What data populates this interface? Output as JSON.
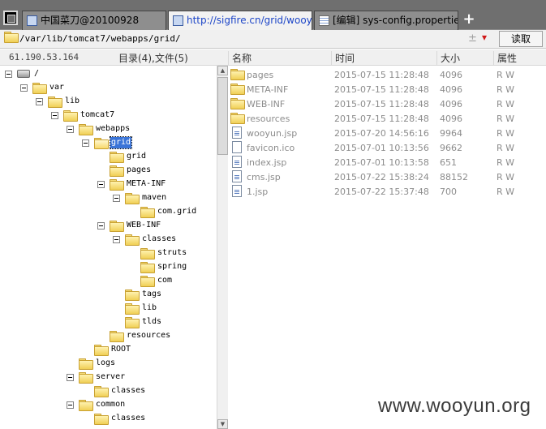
{
  "tabs": [
    {
      "label": "中国菜刀@20100928"
    },
    {
      "label": "http://sigfire.cn/grid/wooyun.j..."
    },
    {
      "label": "[编辑] sys-config.properties"
    }
  ],
  "new_tab_label": "+",
  "pathbar": {
    "path": "/var/lib/tomcat7/webapps/grid/",
    "clear_icon": "±",
    "dropdown_icon": "▾",
    "read_button": "读取"
  },
  "left_header": {
    "ip": "61.190.53.164",
    "count": "目录(4),文件(5)"
  },
  "tree": [
    {
      "label": "/",
      "level": 0,
      "icon": "drive-icon",
      "expanded": true
    },
    {
      "label": "var",
      "level": 1,
      "expanded": true
    },
    {
      "label": "lib",
      "level": 2,
      "expanded": true
    },
    {
      "label": "tomcat7",
      "level": 3,
      "expanded": true
    },
    {
      "label": "webapps",
      "level": 4,
      "expanded": true
    },
    {
      "label": "grid",
      "level": 5,
      "expanded": true,
      "selected": true,
      "open": true
    },
    {
      "label": "grid",
      "level": 6
    },
    {
      "label": "pages",
      "level": 6
    },
    {
      "label": "META-INF",
      "level": 6,
      "expanded": true
    },
    {
      "label": "maven",
      "level": 7,
      "expanded": true
    },
    {
      "label": "com.grid",
      "level": 8
    },
    {
      "label": "WEB-INF",
      "level": 6,
      "expanded": true
    },
    {
      "label": "classes",
      "level": 7,
      "expanded": true
    },
    {
      "label": "struts",
      "level": 8
    },
    {
      "label": "spring",
      "level": 8
    },
    {
      "label": "com",
      "level": 8
    },
    {
      "label": "tags",
      "level": 7
    },
    {
      "label": "lib",
      "level": 7
    },
    {
      "label": "tlds",
      "level": 7
    },
    {
      "label": "resources",
      "level": 6
    },
    {
      "label": "ROOT",
      "level": 5
    },
    {
      "label": "logs",
      "level": 4
    },
    {
      "label": "server",
      "level": 4,
      "expanded": true
    },
    {
      "label": "classes",
      "level": 5
    },
    {
      "label": "common",
      "level": 4,
      "expanded": true
    },
    {
      "label": "classes",
      "level": 5
    }
  ],
  "list_header": {
    "name": "名称",
    "time": "时间",
    "size": "大小",
    "attr": "属性"
  },
  "files": [
    {
      "name": "pages",
      "time": "2015-07-15 11:28:48",
      "size": "4096",
      "attr": "R W",
      "type": "folder"
    },
    {
      "name": "META-INF",
      "time": "2015-07-15 11:28:48",
      "size": "4096",
      "attr": "R W",
      "type": "folder"
    },
    {
      "name": "WEB-INF",
      "time": "2015-07-15 11:28:48",
      "size": "4096",
      "attr": "R W",
      "type": "folder"
    },
    {
      "name": "resources",
      "time": "2015-07-15 11:28:48",
      "size": "4096",
      "attr": "R W",
      "type": "folder"
    },
    {
      "name": "wooyun.jsp",
      "time": "2015-07-20 14:56:16",
      "size": "9964",
      "attr": "R W",
      "type": "file"
    },
    {
      "name": "favicon.ico",
      "time": "2015-07-01 10:13:56",
      "size": "9662",
      "attr": "R W",
      "type": "file-plain"
    },
    {
      "name": "index.jsp",
      "time": "2015-07-01 10:13:58",
      "size": "651",
      "attr": "R W",
      "type": "file"
    },
    {
      "name": "cms.jsp",
      "time": "2015-07-22 15:38:24",
      "size": "88152",
      "attr": "R W",
      "type": "file"
    },
    {
      "name": "1.jsp",
      "time": "2015-07-22 15:37:48",
      "size": "700",
      "attr": "R W",
      "type": "file"
    }
  ],
  "watermark": "www.wooyun.org"
}
